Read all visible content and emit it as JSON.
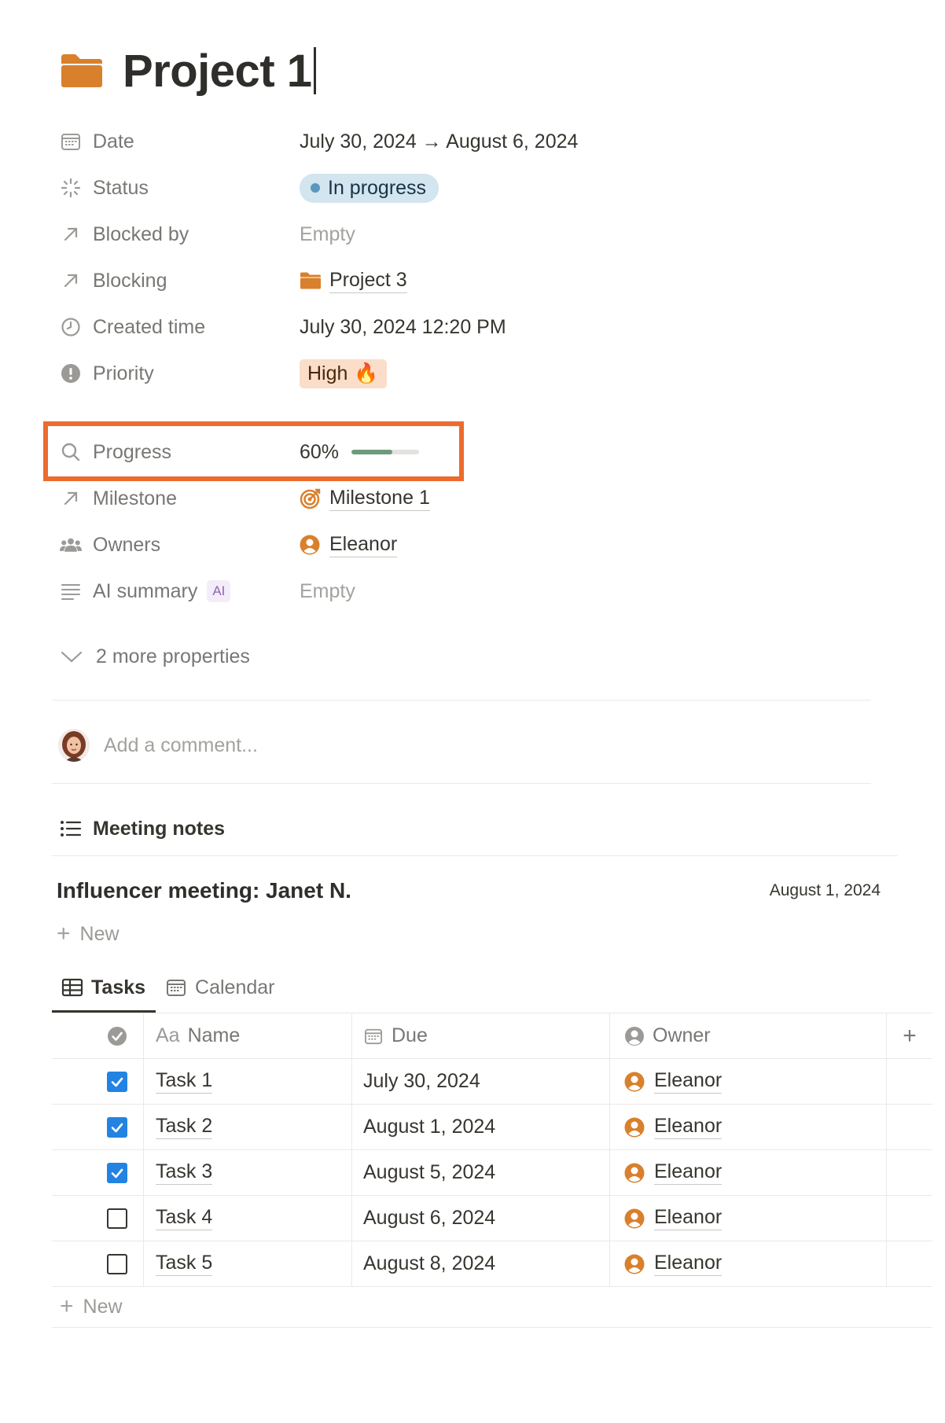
{
  "page": {
    "title": "Project 1",
    "icon": "folder-icon",
    "accent_color": "#d9802c"
  },
  "properties": {
    "date": {
      "label": "Date",
      "value": "July 30, 2024 → August 6, 2024"
    },
    "status": {
      "label": "Status",
      "value": "In progress",
      "color": "#d3e5ef"
    },
    "blocked_by": {
      "label": "Blocked by",
      "value": "Empty"
    },
    "blocking": {
      "label": "Blocking",
      "value": "Project 3"
    },
    "created_time": {
      "label": "Created time",
      "value": "July 30, 2024 12:20 PM"
    },
    "priority": {
      "label": "Priority",
      "value": "High",
      "emoji": "🔥",
      "color": "#fadec9"
    },
    "progress": {
      "label": "Progress",
      "value": "60%",
      "fraction": 0.6,
      "color": "#6d9b7a"
    },
    "milestone": {
      "label": "Milestone",
      "value": "Milestone 1"
    },
    "owners": {
      "label": "Owners",
      "value": "Eleanor"
    },
    "ai_summary": {
      "label": "AI summary",
      "badge": "AI",
      "value": "Empty"
    },
    "more": {
      "label": "2 more properties"
    }
  },
  "highlight": {
    "color": "#ec6b2d",
    "target": "progress"
  },
  "comment": {
    "placeholder": "Add a comment..."
  },
  "meeting_notes": {
    "heading": "Meeting notes",
    "items": [
      {
        "title": "Influencer meeting: Janet N.",
        "date": "August 1, 2024"
      }
    ],
    "new_label": "New"
  },
  "tabs": [
    {
      "label": "Tasks",
      "active": true
    },
    {
      "label": "Calendar",
      "active": false
    }
  ],
  "tasks_table": {
    "columns": {
      "name": "Name",
      "name_prefix": "Aa",
      "due": "Due",
      "owner": "Owner"
    },
    "rows": [
      {
        "done": true,
        "name": "Task 1",
        "due": "July 30, 2024",
        "owner": "Eleanor"
      },
      {
        "done": true,
        "name": "Task 2",
        "due": "August 1, 2024",
        "owner": "Eleanor"
      },
      {
        "done": true,
        "name": "Task 3",
        "due": "August 5, 2024",
        "owner": "Eleanor"
      },
      {
        "done": false,
        "name": "Task 4",
        "due": "August 6, 2024",
        "owner": "Eleanor"
      },
      {
        "done": false,
        "name": "Task 5",
        "due": "August 8, 2024",
        "owner": "Eleanor"
      }
    ],
    "new_label": "New"
  }
}
